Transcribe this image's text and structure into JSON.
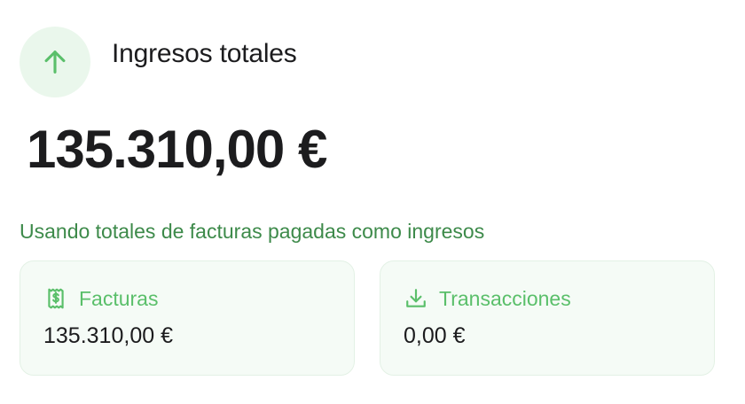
{
  "header": {
    "icon": "arrow-up-icon",
    "title": "Ingresos totales"
  },
  "summary": {
    "total": "135.310,00 €",
    "note": "Usando totales de facturas pagadas como ingresos"
  },
  "cards": [
    {
      "icon": "invoice-dollar-icon",
      "label": "Facturas",
      "value": "135.310,00 €"
    },
    {
      "icon": "download-icon",
      "label": "Transacciones",
      "value": "0,00 €"
    }
  ],
  "colors": {
    "accent": "#5abf6a",
    "note": "#3d8a4a",
    "icon_bg": "#eaf7ec",
    "card_bg": "#f5fbf6",
    "card_border": "#e3f1e5"
  }
}
